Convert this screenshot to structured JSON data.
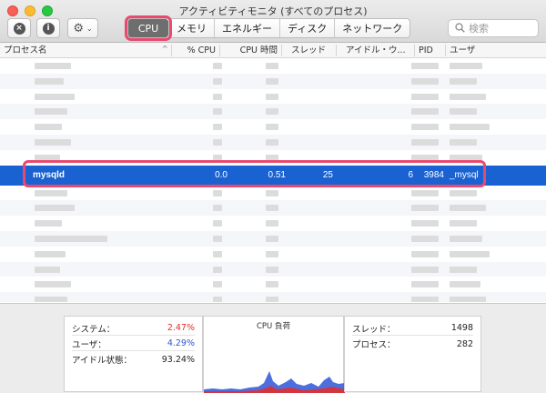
{
  "window": {
    "title": "アクティビティモニタ (すべてのプロセス)"
  },
  "toolbar": {
    "close_glyph": "×",
    "info_glyph": "i",
    "gear_glyph": "⚙",
    "chevron_glyph": "⌄",
    "tabs": [
      {
        "label": "CPU",
        "active": true
      },
      {
        "label": "メモリ",
        "active": false
      },
      {
        "label": "エネルギー",
        "active": false
      },
      {
        "label": "ディスク",
        "active": false
      },
      {
        "label": "ネットワーク",
        "active": false
      }
    ],
    "search_placeholder": "検索",
    "search_icon": "search-icon"
  },
  "columns": {
    "process_name": "プロセス名",
    "cpu_percent": "% CPU",
    "cpu_time": "CPU 時間",
    "threads": "スレッド",
    "idle_wakeups": "アイドル・ウ...",
    "pid": "PID",
    "user": "ユーザ"
  },
  "selected_row": {
    "process_name": "mysqld",
    "cpu_percent": "0.0",
    "cpu_time": "0.51",
    "threads": "25",
    "idle_wakeups": "6",
    "pid": "3984",
    "user": "_mysql"
  },
  "stats": {
    "system_label": "システム：",
    "system_value": "2.47%",
    "user_label": "ユーザ：",
    "user_value": "4.29%",
    "idle_label": "アイドル状態：",
    "idle_value": "93.24%",
    "cpu_load_title": "CPU 負荷",
    "threads_label": "スレッド：",
    "threads_value": "1498",
    "processes_label": "プロセス：",
    "processes_value": "282"
  },
  "colors": {
    "accent_highlight": "#e84a6f",
    "selection_blue": "#1a62d1",
    "system_red": "#e0302f",
    "user_blue": "#2d55d8"
  }
}
